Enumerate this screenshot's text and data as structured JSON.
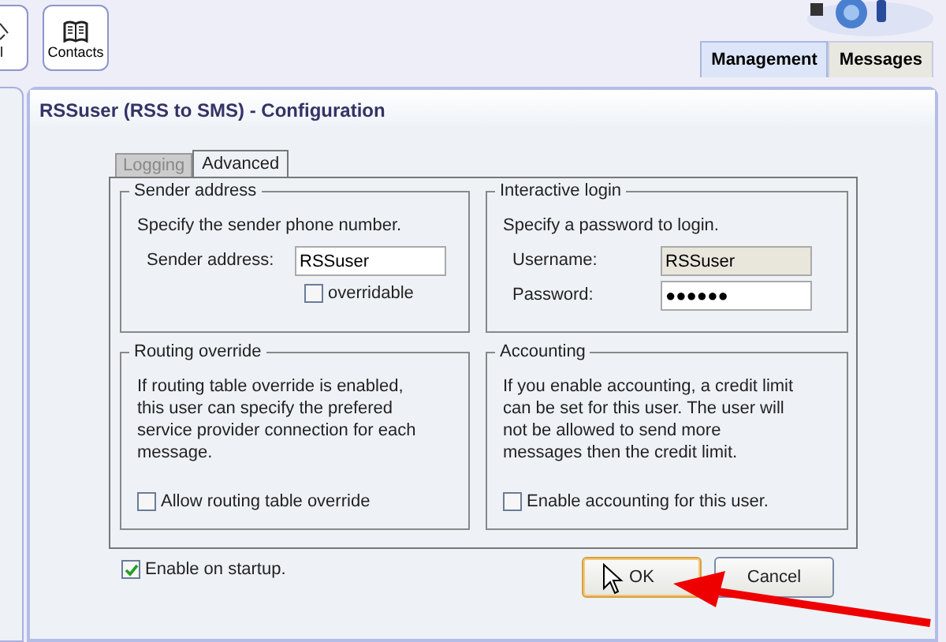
{
  "toolbar": {
    "buttons": [
      {
        "label": "l",
        "kind": "cut"
      },
      {
        "label": "Contacts",
        "kind": "book"
      }
    ]
  },
  "top_tabs": [
    {
      "label": "Management",
      "selected": true
    },
    {
      "label": "Messages",
      "selected": false
    }
  ],
  "panel": {
    "title": "RSSuser (RSS to SMS) - Configuration"
  },
  "tabs": [
    {
      "label": "Logging",
      "selected": false
    },
    {
      "label": "Advanced",
      "selected": true
    }
  ],
  "groups": [
    {
      "title": "Sender address",
      "description": "Specify the sender phone number.",
      "fields": [
        {
          "label": "Sender address:",
          "value": "RSSuser",
          "readonly": false
        }
      ],
      "checkbox": {
        "label": "overridable",
        "checked": false
      }
    },
    {
      "title": "Interactive login",
      "description": "Specify a password to login.",
      "fields": [
        {
          "label": "Username:",
          "value": "RSSuser",
          "readonly": true
        },
        {
          "label": "Password:",
          "value": "●●●●●●",
          "readonly": false
        }
      ]
    },
    {
      "title": "Routing override",
      "description": "If routing table override is enabled, this user can specify the prefered service provider connection for each message.",
      "checkbox": {
        "label": "Allow routing table override",
        "checked": false
      }
    },
    {
      "title": "Accounting",
      "description": "If you enable accounting, a credit limit can be set for this user. The user will not be allowed to send more messages then the credit limit.",
      "checkbox": {
        "label": "Enable accounting for this user.",
        "checked": false
      }
    }
  ],
  "startup": {
    "label": "Enable on startup.",
    "checked": true
  },
  "buttons": [
    {
      "label": "OK",
      "focused": true
    },
    {
      "label": "Cancel",
      "focused": false
    }
  ]
}
